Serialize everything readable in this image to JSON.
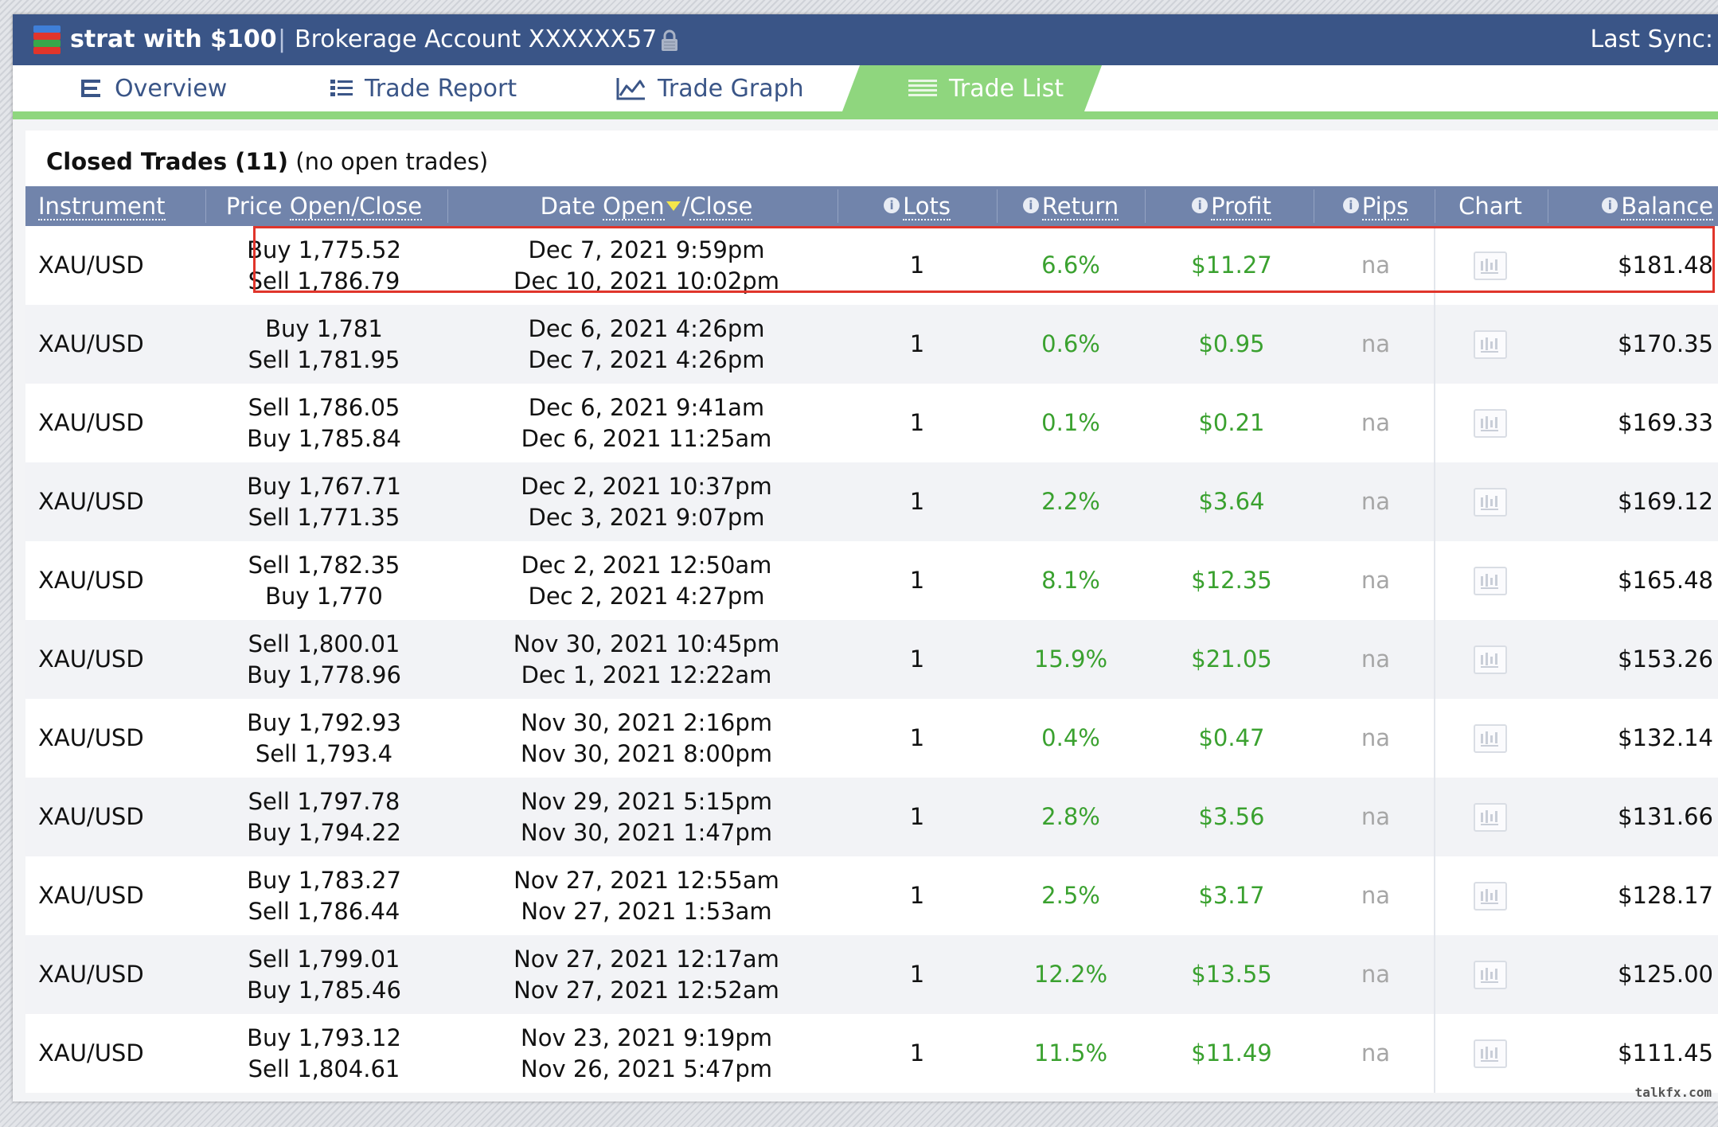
{
  "header": {
    "strategy_name": "strat with $100",
    "separator": "|",
    "account": "Brokerage Account XXXXXX57",
    "last_sync_label": "Last Sync:"
  },
  "tabs": [
    {
      "label": "Overview",
      "icon": "overview-icon"
    },
    {
      "label": "Trade Report",
      "icon": "list-icon"
    },
    {
      "label": "Trade Graph",
      "icon": "line-chart-icon"
    },
    {
      "label": "Trade List",
      "icon": "list-lines-icon",
      "active": true
    }
  ],
  "section": {
    "title": "Closed Trades (11)",
    "subtitle": "(no open trades)"
  },
  "columns": {
    "instrument": "Instrument",
    "price": "Price",
    "price_open": "Open",
    "price_close": "Close",
    "date": "Date",
    "date_open": "Open",
    "date_close": "Close",
    "slash": "/",
    "lots": "Lots",
    "return": "Return",
    "profit": "Profit",
    "pips": "Pips",
    "chart": "Chart",
    "balance": "Balance"
  },
  "trades": [
    {
      "instrument": "XAU/USD",
      "price_open": "Buy 1,775.52",
      "price_close": "Sell 1,786.79",
      "date_open": "Dec 7, 2021 9:59pm",
      "date_close": "Dec 10, 2021 10:02pm",
      "lots": "1",
      "return": "6.6%",
      "profit": "$11.27",
      "pips": "na",
      "balance": "$181.48"
    },
    {
      "instrument": "XAU/USD",
      "price_open": "Buy 1,781",
      "price_close": "Sell 1,781.95",
      "date_open": "Dec 6, 2021 4:26pm",
      "date_close": "Dec 7, 2021 4:26pm",
      "lots": "1",
      "return": "0.6%",
      "profit": "$0.95",
      "pips": "na",
      "balance": "$170.35"
    },
    {
      "instrument": "XAU/USD",
      "price_open": "Sell 1,786.05",
      "price_close": "Buy 1,785.84",
      "date_open": "Dec 6, 2021 9:41am",
      "date_close": "Dec 6, 2021 11:25am",
      "lots": "1",
      "return": "0.1%",
      "profit": "$0.21",
      "pips": "na",
      "balance": "$169.33"
    },
    {
      "instrument": "XAU/USD",
      "price_open": "Buy 1,767.71",
      "price_close": "Sell 1,771.35",
      "date_open": "Dec 2, 2021 10:37pm",
      "date_close": "Dec 3, 2021 9:07pm",
      "lots": "1",
      "return": "2.2%",
      "profit": "$3.64",
      "pips": "na",
      "balance": "$169.12"
    },
    {
      "instrument": "XAU/USD",
      "price_open": "Sell 1,782.35",
      "price_close": "Buy 1,770",
      "date_open": "Dec 2, 2021 12:50am",
      "date_close": "Dec 2, 2021 4:27pm",
      "lots": "1",
      "return": "8.1%",
      "profit": "$12.35",
      "pips": "na",
      "balance": "$165.48"
    },
    {
      "instrument": "XAU/USD",
      "price_open": "Sell 1,800.01",
      "price_close": "Buy 1,778.96",
      "date_open": "Nov 30, 2021 10:45pm",
      "date_close": "Dec 1, 2021 12:22am",
      "lots": "1",
      "return": "15.9%",
      "profit": "$21.05",
      "pips": "na",
      "balance": "$153.26"
    },
    {
      "instrument": "XAU/USD",
      "price_open": "Buy 1,792.93",
      "price_close": "Sell 1,793.4",
      "date_open": "Nov 30, 2021 2:16pm",
      "date_close": "Nov 30, 2021 8:00pm",
      "lots": "1",
      "return": "0.4%",
      "profit": "$0.47",
      "pips": "na",
      "balance": "$132.14"
    },
    {
      "instrument": "XAU/USD",
      "price_open": "Sell 1,797.78",
      "price_close": "Buy 1,794.22",
      "date_open": "Nov 29, 2021 5:15pm",
      "date_close": "Nov 30, 2021 1:47pm",
      "lots": "1",
      "return": "2.8%",
      "profit": "$3.56",
      "pips": "na",
      "balance": "$131.66"
    },
    {
      "instrument": "XAU/USD",
      "price_open": "Buy 1,783.27",
      "price_close": "Sell 1,786.44",
      "date_open": "Nov 27, 2021 12:55am",
      "date_close": "Nov 27, 2021 1:53am",
      "lots": "1",
      "return": "2.5%",
      "profit": "$3.17",
      "pips": "na",
      "balance": "$128.17"
    },
    {
      "instrument": "XAU/USD",
      "price_open": "Sell 1,799.01",
      "price_close": "Buy 1,785.46",
      "date_open": "Nov 27, 2021 12:17am",
      "date_close": "Nov 27, 2021 12:52am",
      "lots": "1",
      "return": "12.2%",
      "profit": "$13.55",
      "pips": "na",
      "balance": "$125.00"
    },
    {
      "instrument": "XAU/USD",
      "price_open": "Buy 1,793.12",
      "price_close": "Sell 1,804.61",
      "date_open": "Nov 23, 2021 9:19pm",
      "date_close": "Nov 26, 2021 5:47pm",
      "lots": "1",
      "return": "11.5%",
      "profit": "$11.49",
      "pips": "na",
      "balance": "$111.45"
    }
  ],
  "watermark": "talkfx.com",
  "colors": {
    "header_bg": "#3a5587",
    "tab_active": "#8fd67e",
    "table_header_bg": "#7184ab",
    "positive": "#3aa12f",
    "highlight_border": "#e0352b"
  }
}
